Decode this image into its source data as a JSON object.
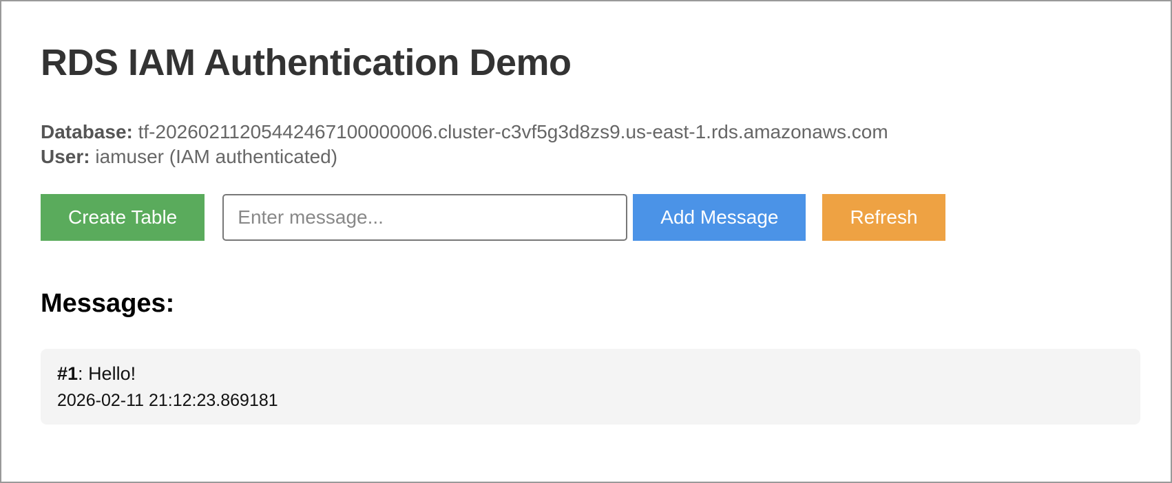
{
  "page": {
    "title": "RDS IAM Authentication Demo"
  },
  "connection": {
    "database_label": "Database:",
    "database_value": " tf-20260211205442467100000006.cluster-c3vf5g3d8zs9.us-east-1.rds.amazonaws.com",
    "user_label": "User:",
    "user_value": " iamuser (IAM authenticated)"
  },
  "toolbar": {
    "create_table_label": "Create Table",
    "message_input_placeholder": "Enter message...",
    "message_input_value": "",
    "add_message_label": "Add Message",
    "refresh_label": "Refresh"
  },
  "messages": {
    "heading": "Messages:",
    "items": [
      {
        "id_label": "#1",
        "separator": ": ",
        "text": "Hello!",
        "timestamp": "2026-02-11 21:12:23.869181"
      }
    ]
  },
  "colors": {
    "create_table_bg": "#5aab5c",
    "add_message_bg": "#4b93e7",
    "refresh_bg": "#eea243",
    "message_card_bg": "#f4f4f4",
    "page_border": "#999999",
    "title_text": "#333333",
    "info_text": "#666666"
  }
}
